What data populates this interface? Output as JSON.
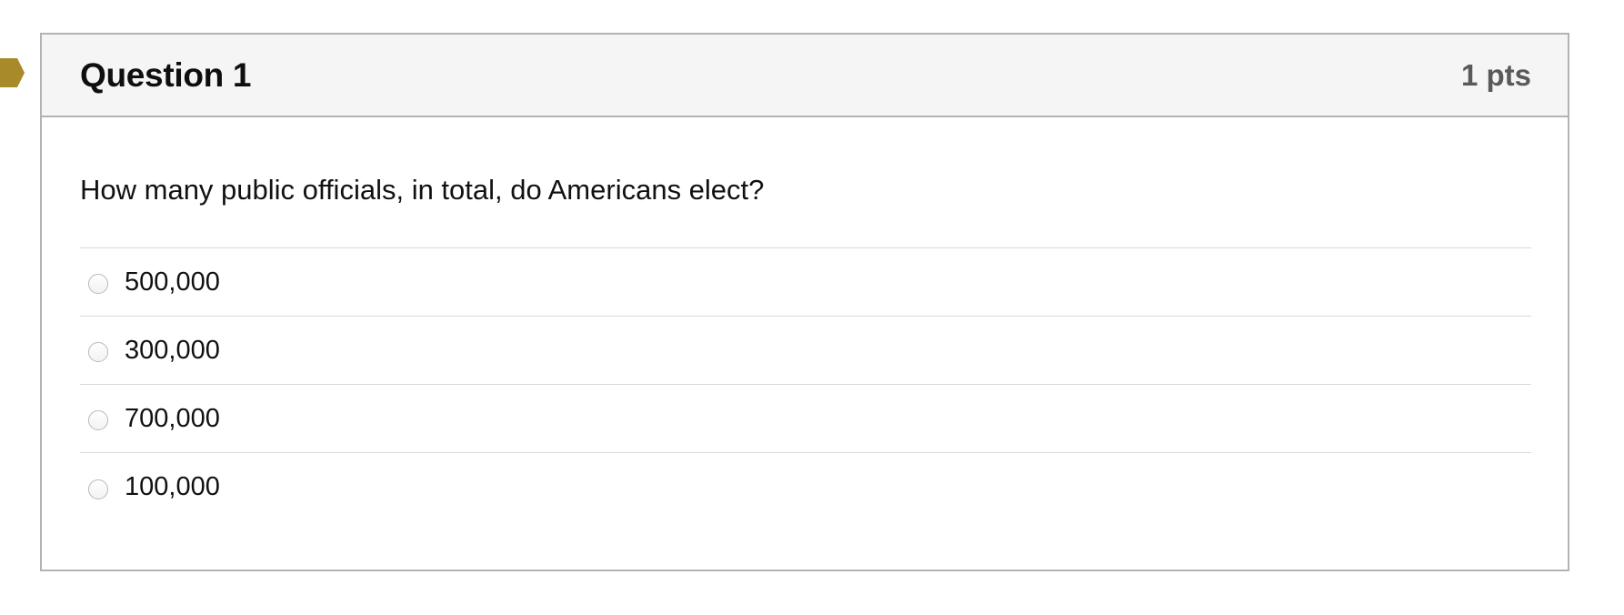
{
  "question": {
    "title": "Question 1",
    "points": "1 pts",
    "text": "How many public officials, in total, do Americans elect?",
    "answers": [
      {
        "label": "500,000",
        "selected": false
      },
      {
        "label": "300,000",
        "selected": false
      },
      {
        "label": "700,000",
        "selected": false
      },
      {
        "label": "100,000",
        "selected": false
      }
    ]
  },
  "colors": {
    "flag_marker": "#a98a2a",
    "header_background": "#f5f5f5",
    "border": "#b3b3b3",
    "points_text": "#5a5a5a"
  },
  "icons": {
    "flag_marker": "flag-marker-icon",
    "radio": "radio-unchecked-icon"
  }
}
